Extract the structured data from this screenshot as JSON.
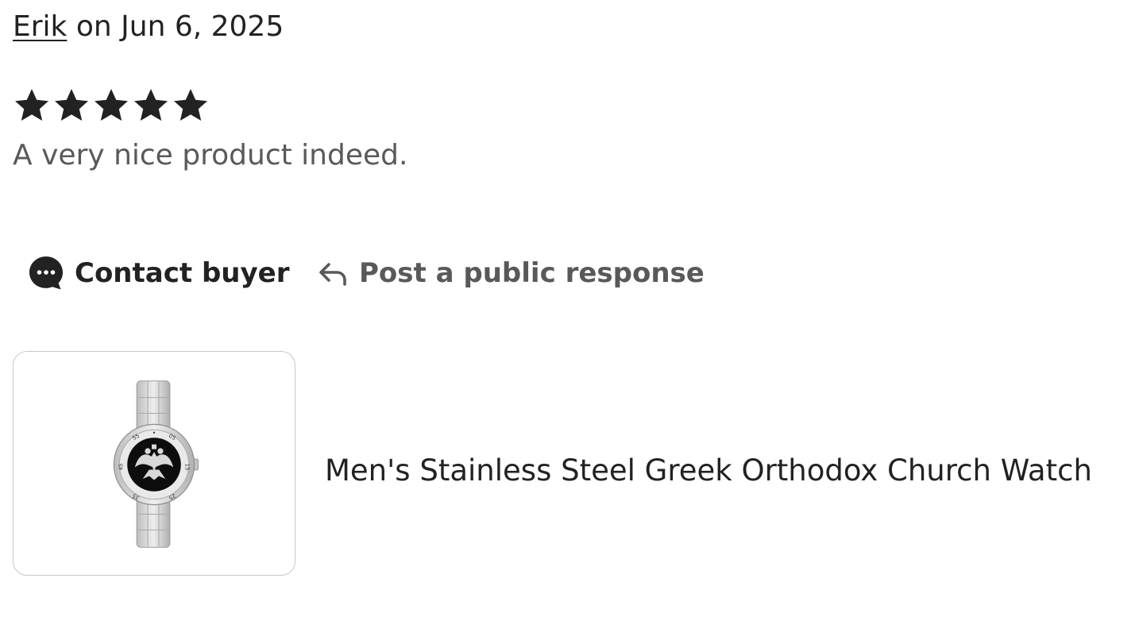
{
  "review": {
    "author": "Erik",
    "date_text": " on Jun 6, 2025",
    "rating": 5,
    "rating_max": 5,
    "text": "A very nice product indeed."
  },
  "actions": {
    "contact_label": "Contact buyer",
    "contact_icon": "chat-bubble-icon",
    "respond_label": "Post a public response",
    "respond_icon": "reply-arrow-icon"
  },
  "product": {
    "title": "Men's Stainless Steel Greek Orthodox Church Watch",
    "image_icon": "watch-image",
    "watch_bezel_marks": [
      "05",
      "15",
      "25",
      "35",
      "45",
      "55"
    ]
  },
  "colors": {
    "text_primary": "#222222",
    "text_secondary": "#595959",
    "card_border": "#c8c8c8"
  }
}
